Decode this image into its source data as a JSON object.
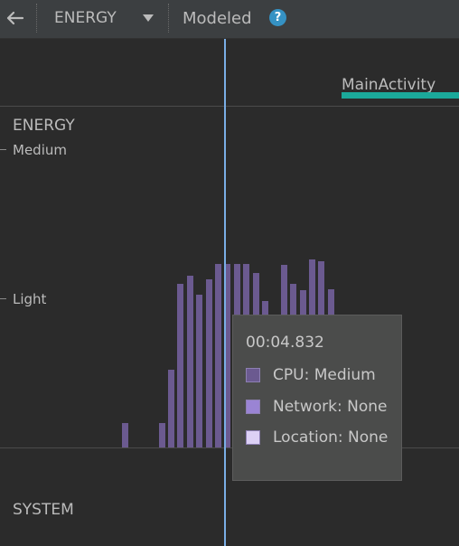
{
  "toolbar": {
    "back_icon": "arrow-left-icon",
    "stage": "ENERGY",
    "mode": "Modeled",
    "help_icon": "?"
  },
  "activity": {
    "name": "MainActivity",
    "color": "#1ba99a"
  },
  "energy": {
    "title": "ENERGY",
    "levels": [
      "Medium",
      "Light"
    ]
  },
  "system": {
    "title": "SYSTEM"
  },
  "tooltip": {
    "time": "00:04.832",
    "rows": [
      {
        "label": "CPU: Medium",
        "color": "#6b5a90"
      },
      {
        "label": "Network: None",
        "color": "#9a84d4"
      },
      {
        "label": "Location: None",
        "color": "#dcd0f5"
      }
    ]
  },
  "colors": {
    "energy_bar": "#6b5a90",
    "cursor": "#7aaee6"
  }
}
